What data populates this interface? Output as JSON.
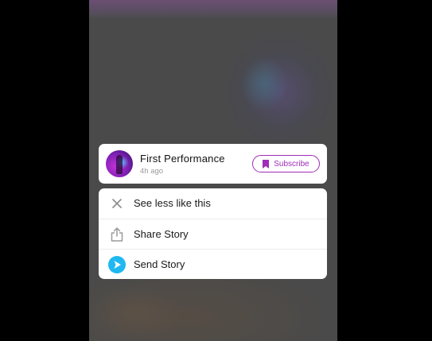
{
  "story": {
    "title": "First Performance",
    "time": "4h ago",
    "subscribe_label": "Subscribe"
  },
  "menu": {
    "items": [
      {
        "label": "See less like this",
        "icon": "close-icon"
      },
      {
        "label": "Share Story",
        "icon": "share-icon"
      },
      {
        "label": "Send Story",
        "icon": "send-icon"
      }
    ]
  },
  "colors": {
    "accent": "#a02cb8",
    "send_blue": "#1fb8f0"
  }
}
